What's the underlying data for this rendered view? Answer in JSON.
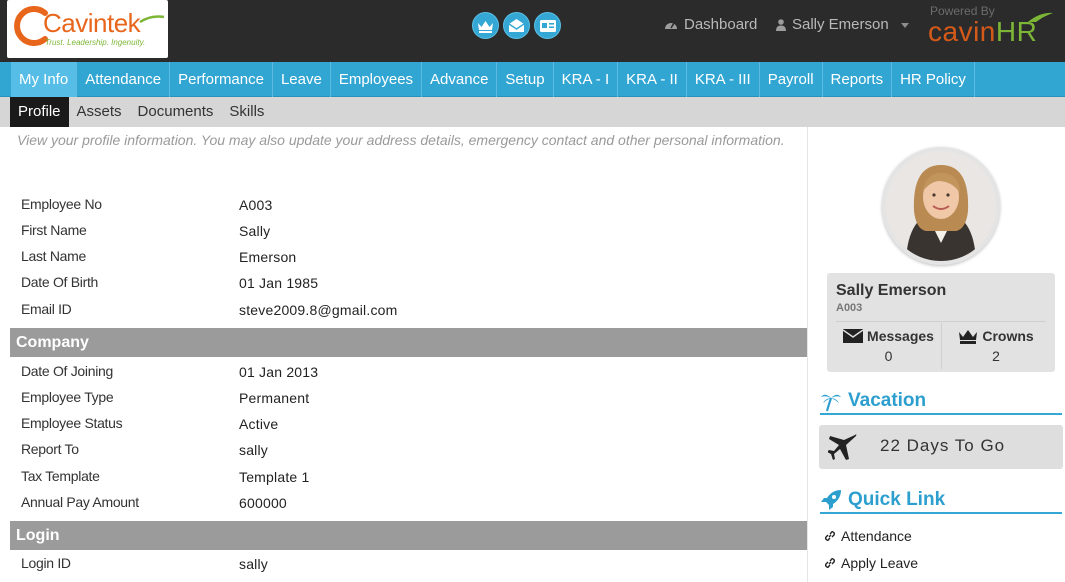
{
  "brand": {
    "name": "Cavintek",
    "tagline": "Trust. Leadership. Ingenuity.",
    "powered_by": "Powered By",
    "product_main": "cavin",
    "product_suffix": "HR"
  },
  "header": {
    "icons": [
      "crown-icon",
      "envelope-icon",
      "id-card-icon"
    ],
    "dashboard_label": "Dashboard",
    "user_label": "Sally Emerson"
  },
  "main_nav": [
    {
      "label": "My Info",
      "active": true
    },
    {
      "label": "Attendance"
    },
    {
      "label": "Performance"
    },
    {
      "label": "Leave"
    },
    {
      "label": "Employees"
    },
    {
      "label": "Advance"
    },
    {
      "label": "Setup"
    },
    {
      "label": "KRA - I"
    },
    {
      "label": "KRA - II"
    },
    {
      "label": "KRA - III"
    },
    {
      "label": "Payroll"
    },
    {
      "label": "Reports"
    },
    {
      "label": "HR Policy"
    }
  ],
  "sub_nav": [
    {
      "label": "Profile",
      "active": true
    },
    {
      "label": "Assets"
    },
    {
      "label": "Documents"
    },
    {
      "label": "Skills"
    }
  ],
  "profile": {
    "intro": "View your profile information. You may also update your address details, emergency contact and other personal information.",
    "personal": [
      {
        "label": "Employee No",
        "value": "A003"
      },
      {
        "label": "First Name",
        "value": "Sally"
      },
      {
        "label": "Last Name",
        "value": "Emerson"
      },
      {
        "label": "Date Of Birth",
        "value": "01 Jan 1985"
      },
      {
        "label": "Email ID",
        "value": "steve2009.8@gmail.com"
      }
    ],
    "company_heading": "Company",
    "company": [
      {
        "label": "Date Of Joining",
        "value": "01 Jan 2013"
      },
      {
        "label": "Employee Type",
        "value": "Permanent"
      },
      {
        "label": "Employee Status",
        "value": "Active"
      },
      {
        "label": "Report To",
        "value": "sally"
      },
      {
        "label": "Tax Template",
        "value": "Template 1"
      },
      {
        "label": "Annual Pay Amount",
        "value": "600000"
      }
    ],
    "login_heading": "Login",
    "login": [
      {
        "label": "Login ID",
        "value": "sally"
      }
    ]
  },
  "sidebar": {
    "name": "Sally Emerson",
    "employee_id": "A003",
    "messages_label": "Messages",
    "messages_count": "0",
    "crowns_label": "Crowns",
    "crowns_count": "2",
    "vacation_heading": "Vacation",
    "vacation_text": "22 Days To Go",
    "quick_link_heading": "Quick Link",
    "quick_links": [
      "Attendance",
      "Apply Leave"
    ]
  },
  "colors": {
    "header_bg": "#2b2b2b",
    "nav_blue": "#32a6d2",
    "accent_orange": "#e8661c",
    "accent_green": "#7db637",
    "section_gray": "#9b9b9b"
  }
}
